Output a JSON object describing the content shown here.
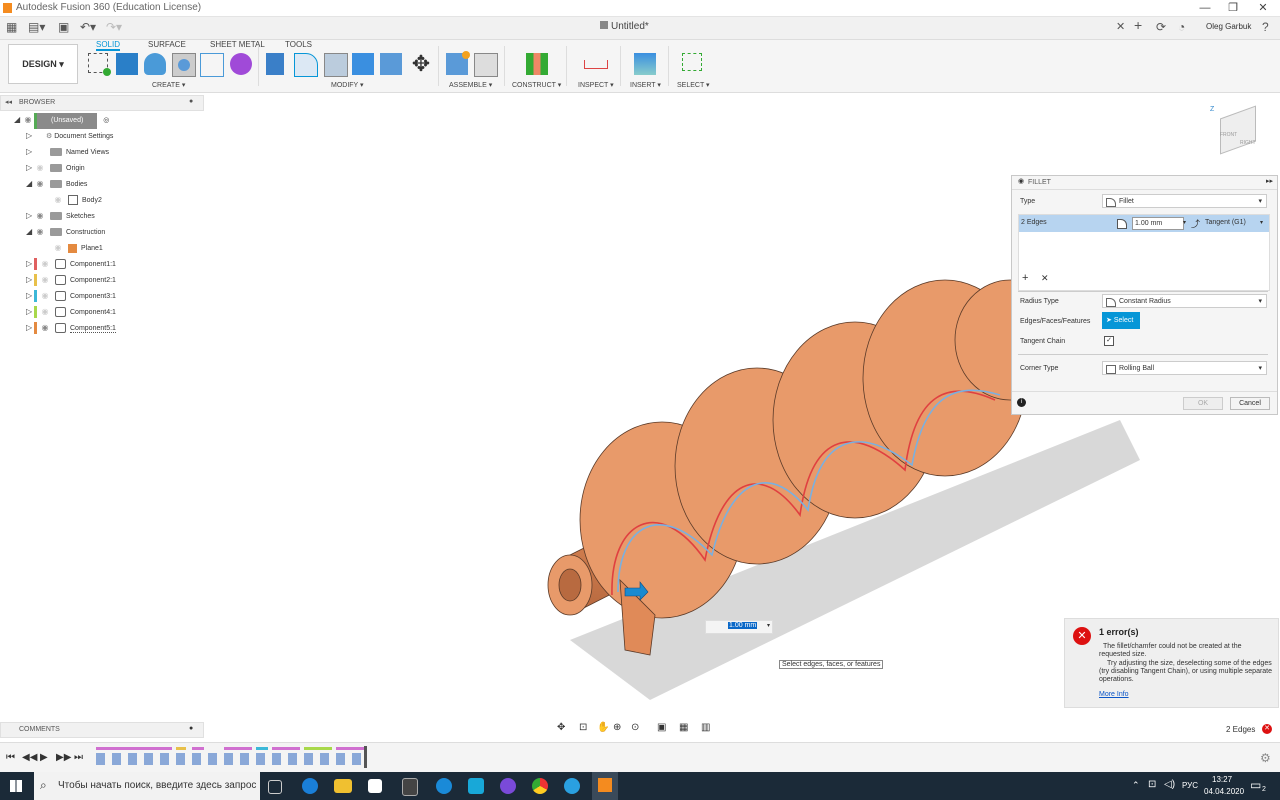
{
  "window": {
    "title": "Autodesk Fusion 360 (Education License)"
  },
  "tabbar": {
    "document_title": "Untitled*",
    "user": "Oleg Garbuk"
  },
  "ribbon": {
    "workspace": "DESIGN",
    "tabs": [
      "SOLID",
      "SURFACE",
      "SHEET METAL",
      "TOOLS"
    ],
    "groups": [
      "CREATE",
      "MODIFY",
      "ASSEMBLE",
      "CONSTRUCT",
      "INSPECT",
      "INSERT",
      "SELECT"
    ]
  },
  "browser": {
    "header": "BROWSER",
    "root": "(Unsaved)",
    "items": [
      "Document Settings",
      "Named Views",
      "Origin",
      "Bodies",
      "Body2",
      "Sketches",
      "Construction",
      "Plane1",
      "Component1:1",
      "Component2:1",
      "Component3:1",
      "Component4:1",
      "Component5:1"
    ],
    "component_colors": [
      "#e06060",
      "#e8c04a",
      "#3cb8d8",
      "#a8d84a",
      "#e48a40"
    ]
  },
  "fillet": {
    "title": "FILLET",
    "type_label": "Type",
    "type_value": "Fillet",
    "edges_label": "2 Edges",
    "radius_value": "1.00 mm",
    "continuity": "Tangent (G1)",
    "radius_type_label": "Radius Type",
    "radius_type_value": "Constant Radius",
    "selection_label": "Edges/Faces/Features",
    "select_button": "Select",
    "tangent_chain_label": "Tangent Chain",
    "corner_type_label": "Corner Type",
    "corner_type_value": "Rolling Ball",
    "ok": "OK",
    "cancel": "Cancel"
  },
  "canvas": {
    "radius_input": "1.00 mm",
    "tooltip": "Select edges, faces, or features",
    "viewcube_label": "FRONT",
    "viewcube_right": "RIGHT",
    "axis_z": "Z"
  },
  "error": {
    "title": "1 error(s)",
    "line1": "The fillet/chamfer could not be created at the requested size.",
    "line2": "Try adjusting the size, deselecting some of the edges (try disabling Tangent Chain), or using multiple separate operations.",
    "link": "More Info"
  },
  "comments": {
    "label": "COMMENTS"
  },
  "status": {
    "selection": "2 Edges"
  },
  "taskbar": {
    "search_placeholder": "Чтобы начать поиск, введите здесь запрос",
    "lang": "РУС",
    "time": "13:27",
    "date": "04.04.2020",
    "notification_count": "2"
  },
  "colors": {
    "accent": "#0696d7",
    "model": "#e89a6a",
    "model_dark": "#b86a40",
    "error": "#d11"
  }
}
